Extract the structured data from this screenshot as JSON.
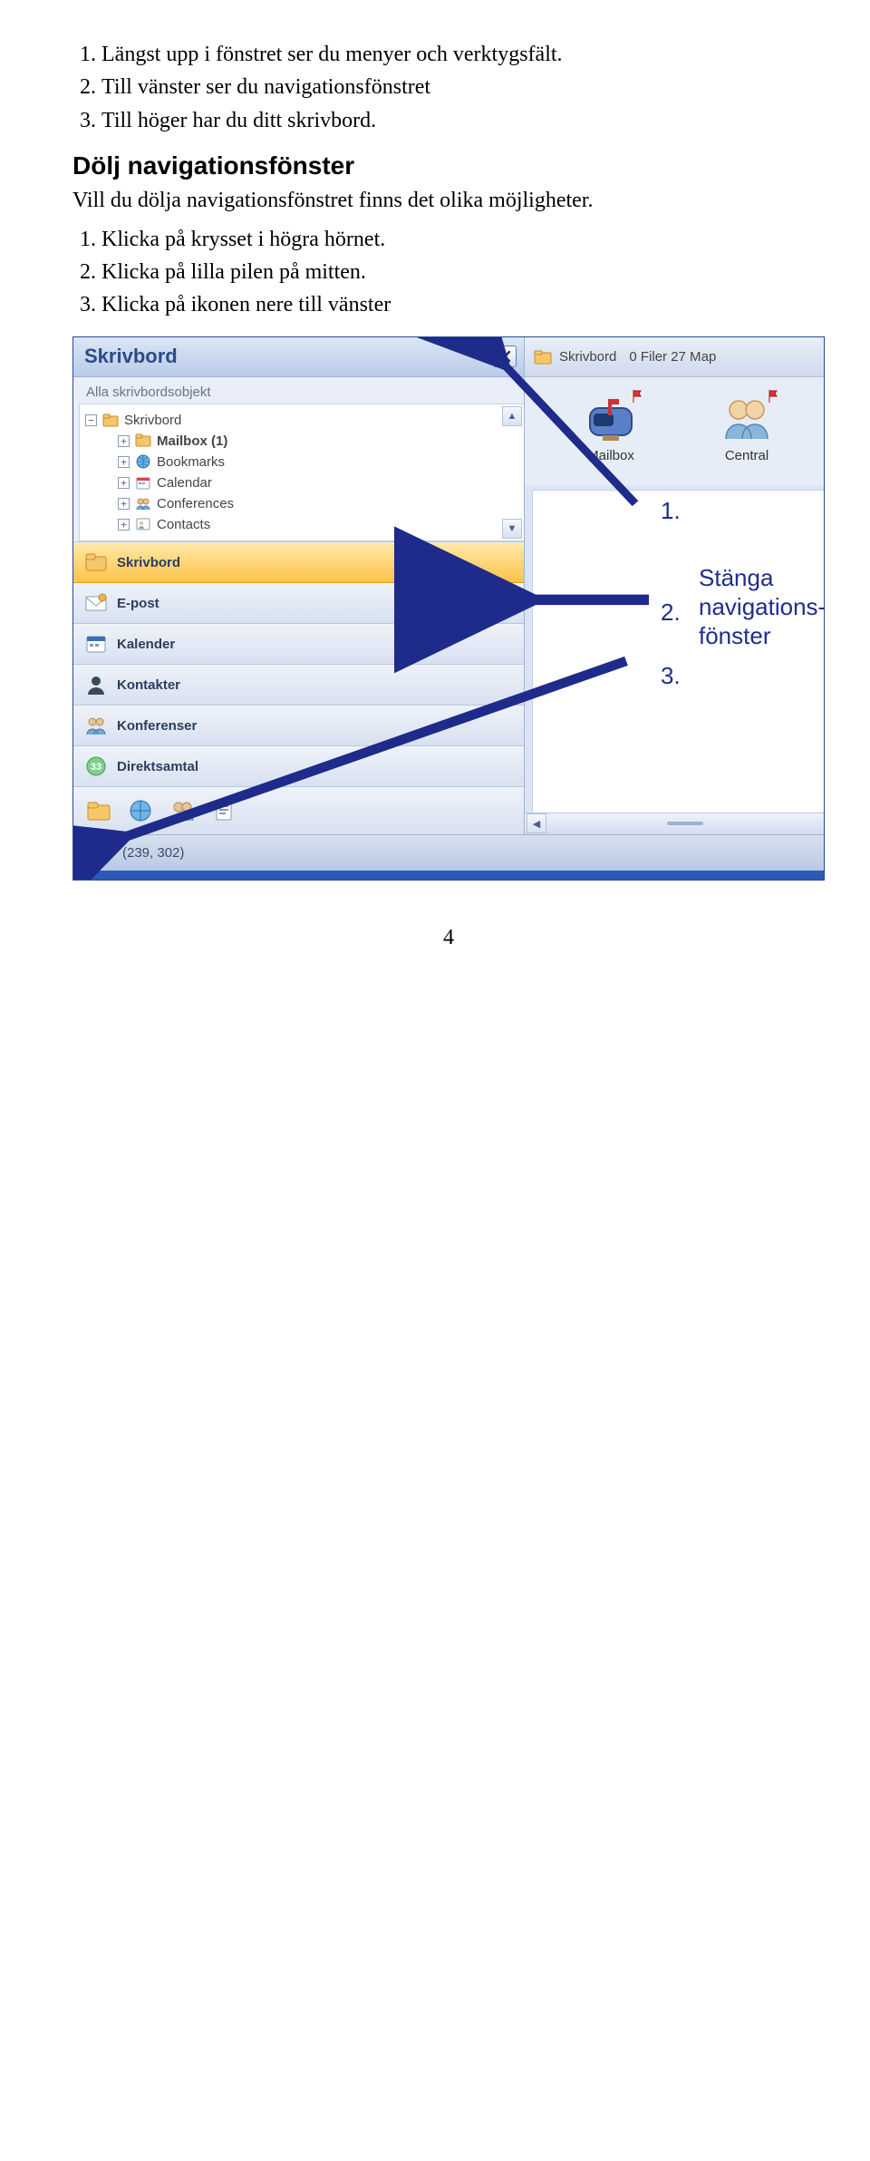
{
  "intro_list": [
    "Längst upp i fönstret ser du menyer och verktygsfält.",
    "Till vänster ser du navigationsfönstret",
    "Till höger har du ditt skrivbord."
  ],
  "section_heading": "Dölj navigationsfönster",
  "section_lead": "Vill du dölja navigationsfönstret finns det olika möjligheter.",
  "hide_list": [
    "Klicka på krysset i högra hörnet.",
    "Klicka på lilla pilen på mitten.",
    "Klicka på ikonen nere till vänster"
  ],
  "page_number": "4",
  "nav": {
    "title": "Skrivbord",
    "subtitle": "Alla skrivbordsobjekt",
    "tree": {
      "root": "Skrivbord",
      "children": [
        "Mailbox (1)",
        "Bookmarks",
        "Calendar",
        "Conferences",
        "Contacts"
      ]
    },
    "stack": [
      "Skrivbord",
      "E-post",
      "Kalender",
      "Kontakter",
      "Konferenser",
      "Direktsamtal"
    ]
  },
  "content": {
    "breadcrumb": "Skrivbord",
    "status": "0 Filer  27 Мар",
    "icons": [
      {
        "label": "Mailbox"
      },
      {
        "label": "Central"
      }
    ]
  },
  "statusbar": {
    "coords": "(239, 302)"
  },
  "annotation": {
    "num1": "1.",
    "num2": "2.",
    "num3": "3.",
    "caption_line1": "Stänga",
    "caption_line2": "navigations-",
    "caption_line3": "fönster"
  }
}
